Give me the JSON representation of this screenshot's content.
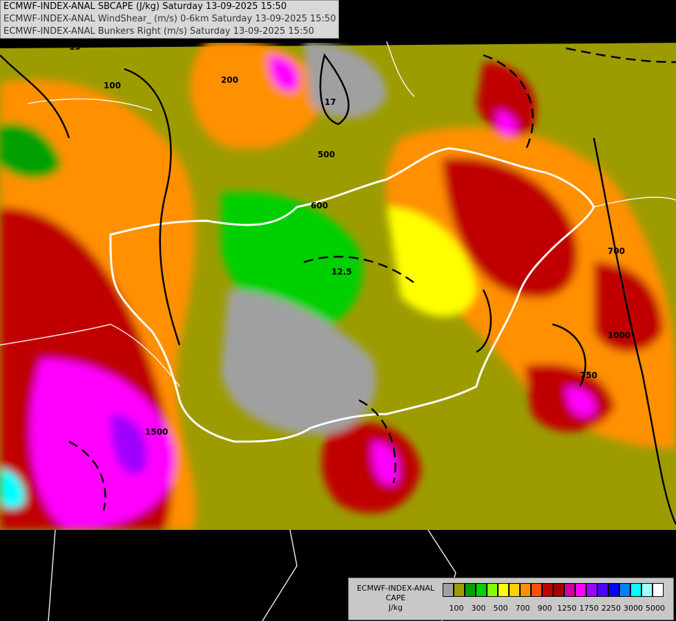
{
  "header": {
    "line1": "ECMWF-INDEX-ANAL SBCAPE (J/kg) Saturday 13-09-2025 15:50",
    "line2": "ECMWF-INDEX-ANAL WindShear_ (m/s) 0-6km Saturday 13-09-2025 15:50",
    "line3": "ECMWF-INDEX-ANAL Bunkers Right (m/s) Saturday 13-09-2025 15:50"
  },
  "legend": {
    "title_line1": "ECMWF-INDEX-ANAL",
    "title_line2": "CAPE",
    "title_line3": "J/kg",
    "colors": [
      "#a0a0a0",
      "#9c9c00",
      "#00a000",
      "#00d000",
      "#80ff00",
      "#ffff00",
      "#ffd000",
      "#ff9000",
      "#ff5000",
      "#c00000",
      "#a00000",
      "#d000a0",
      "#ff00ff",
      "#a000ff",
      "#5000ff",
      "#0000ff",
      "#0080ff",
      "#00ffff",
      "#a0ffff",
      "#ffffff"
    ],
    "tick_labels": [
      "100",
      "300",
      "500",
      "700",
      "900",
      "1250",
      "1750",
      "2250",
      "3000",
      "5000"
    ]
  },
  "map_labels": [
    {
      "text": "15"
    },
    {
      "text": "100"
    },
    {
      "text": "200"
    },
    {
      "text": "500"
    },
    {
      "text": "600"
    },
    {
      "text": "12.5"
    },
    {
      "text": "17"
    },
    {
      "text": "700"
    },
    {
      "text": "1500"
    },
    {
      "text": "750"
    },
    {
      "text": "1000"
    }
  ]
}
